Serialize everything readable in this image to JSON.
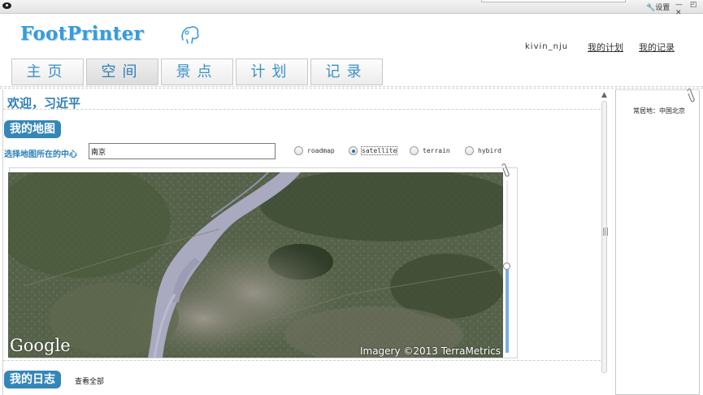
{
  "titlebar": {
    "settings_label": "设置",
    "controls": "— ◰ ✕"
  },
  "header": {
    "logo_text": "FootPrinter",
    "username": "kivin_nju",
    "my_plan_link": "我的计划",
    "my_record_link": "我的记录"
  },
  "nav": {
    "tabs": [
      {
        "label": "主页",
        "active": false
      },
      {
        "label": "空间",
        "active": true
      },
      {
        "label": "景点",
        "active": false
      },
      {
        "label": "计划",
        "active": false
      },
      {
        "label": "记录",
        "active": false
      }
    ]
  },
  "main": {
    "welcome": "欢迎，习近平",
    "map_section": {
      "title": "我的地图",
      "center_label": "选择地图所在的中心",
      "center_value": "南京",
      "map_types": [
        {
          "label": "roadmap",
          "checked": false
        },
        {
          "label": "satellite",
          "checked": true
        },
        {
          "label": "terrain",
          "checked": false
        },
        {
          "label": "hybird",
          "checked": false
        }
      ],
      "google_logo": "Google",
      "attribution": "Imagery ©2013 TerraMetrics"
    },
    "journal_section": {
      "title": "我的日志",
      "view_all": "查看全部"
    }
  },
  "sidebar": {
    "residence": "常居地：中国北京"
  },
  "colors": {
    "accent": "#3a9bd9",
    "section_pill": "#3486b8",
    "river": "#a9aac0",
    "land": "#4d5a3c"
  }
}
